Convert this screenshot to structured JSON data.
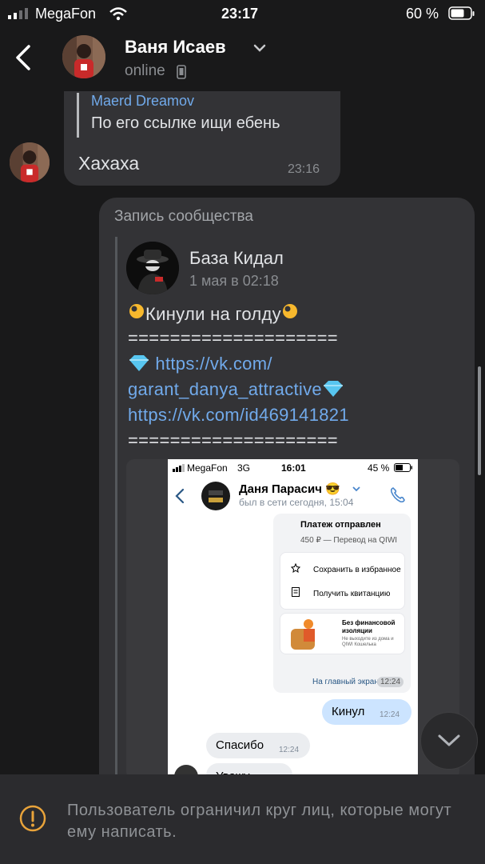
{
  "status_bar": {
    "carrier": "MegaFon",
    "time": "23:17",
    "battery": "60 %"
  },
  "header": {
    "name": "Ваня Исаев",
    "status": "online"
  },
  "messages": {
    "quote_author": "Maerd Dreamov",
    "quote_text": "По его ссылке ищи ебень",
    "text": "Хахаха",
    "time": "23:16"
  },
  "repost": {
    "label": "Запись сообщества",
    "group_name": "База Кидал",
    "date": "1 мая в 02:18",
    "title": "Кинули на голду",
    "divider": "====================",
    "link1_a": "https://vk.com/",
    "link1_b": "garant_danya_attractive",
    "link2": "https://vk.com/id469141821"
  },
  "screenshot": {
    "carrier": "MegaFon",
    "network": "3G",
    "time": "16:01",
    "battery": "45 %",
    "contact_name": "Даня Парасич 😎",
    "last_seen": "был в сети сегодня, 15:04",
    "payment_title": "Платеж отправлен",
    "payment_sub": "450 ₽ — Перевод на QIWI",
    "save_fav": "Сохранить в избранное",
    "get_receipt": "Получить квитанцию",
    "promo_title": "Без финансовой изоляции",
    "promo_sub": "Не выходите из дома и QIWI Кошелька",
    "home_link": "На главный экран",
    "time1": "12:24",
    "msg_out": "Кинул",
    "time2": "12:24",
    "msg_in": "Спасибо",
    "time3": "12:24",
    "msg_cut": "Уважу"
  },
  "footer": {
    "notice": "Пользователь ограничил круг лиц, которые могут ему написать."
  },
  "colors": {
    "background": "#19191a",
    "bubble": "#333336",
    "link": "#71aaeb",
    "footer": "#2b2b2e"
  },
  "icons": [
    "back-arrow-icon",
    "chevron-down-icon",
    "phone-device-icon",
    "ok-hand-emoji",
    "gem-emoji",
    "scroll-down-icon",
    "warning-icon"
  ]
}
